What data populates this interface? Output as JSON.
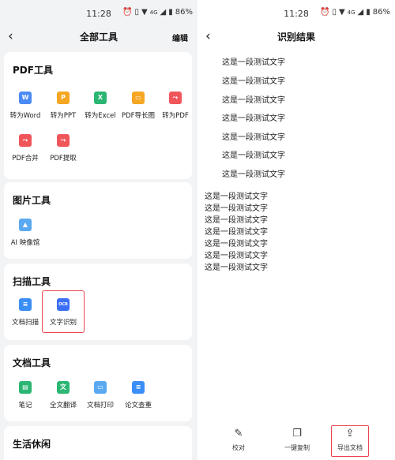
{
  "status": {
    "time": "11:28",
    "network": "4G",
    "battery": "86%"
  },
  "left": {
    "title": "全部工具",
    "edit_label": "编辑",
    "sections": [
      {
        "title": "PDF工具",
        "tools": [
          {
            "label": "转为Word",
            "icon": "word-icon",
            "color": "#4a8af4",
            "glyph": "W"
          },
          {
            "label": "转为PPT",
            "icon": "ppt-icon",
            "color": "#f5a623",
            "glyph": "P"
          },
          {
            "label": "转为Excel",
            "icon": "excel-icon",
            "color": "#2bb673",
            "glyph": "X"
          },
          {
            "label": "PDF导长图",
            "icon": "long-image-icon",
            "color": "#f5a623",
            "glyph": "▭"
          },
          {
            "label": "转为PDF",
            "icon": "pdf-icon",
            "color": "#f0555a",
            "glyph": "⤳"
          },
          {
            "label": "PDF合并",
            "icon": "pdf-merge-icon",
            "color": "#f0555a",
            "glyph": "⤳"
          },
          {
            "label": "PDF提取",
            "icon": "pdf-extract-icon",
            "color": "#f0555a",
            "glyph": "⤳"
          }
        ]
      },
      {
        "title": "图片工具",
        "tools": [
          {
            "label": "AI 映像馆",
            "icon": "ai-image-icon",
            "color": "#5aa9f0",
            "glyph": "▲"
          }
        ]
      },
      {
        "title": "扫描工具",
        "tools": [
          {
            "label": "文档扫描",
            "icon": "doc-scan-icon",
            "color": "#3a8ef6",
            "glyph": "≡"
          },
          {
            "label": "文字识别",
            "icon": "ocr-icon",
            "color": "#3a6ff6",
            "glyph": "OCR"
          }
        ]
      },
      {
        "title": "文档工具",
        "tools": [
          {
            "label": "笔记",
            "icon": "note-icon",
            "color": "#2bb673",
            "glyph": "▤"
          },
          {
            "label": "全文翻译",
            "icon": "translate-icon",
            "color": "#2bb673",
            "glyph": "文"
          },
          {
            "label": "文档打印",
            "icon": "print-icon",
            "color": "#5aa9f0",
            "glyph": "▭"
          },
          {
            "label": "论文查重",
            "icon": "paper-check-icon",
            "color": "#3a8ef6",
            "glyph": "≡"
          }
        ]
      },
      {
        "title": "生活休闲",
        "tools": []
      }
    ]
  },
  "right": {
    "title": "识别结果",
    "indented_lines": [
      "这是一段测试文字",
      "这是一段测试文字",
      "这是一段测试文字",
      "这是一段测试文字",
      "这是一段测试文字",
      "这是一段测试文字",
      "这是一段测试文字"
    ],
    "plain_lines": [
      "这是一段测试文字",
      "这是一段测试文字",
      "这是一段测试文字",
      "这是一段测试文字",
      "这是一段测试文字",
      "这是一段测试文字",
      "这是一段测试文字"
    ],
    "actions": [
      {
        "label": "校对",
        "icon": "proofread-icon",
        "glyph": "✎"
      },
      {
        "label": "一键复制",
        "icon": "copy-icon",
        "glyph": "❐"
      },
      {
        "label": "导出文档",
        "icon": "export-icon",
        "glyph": "⇪"
      }
    ]
  }
}
